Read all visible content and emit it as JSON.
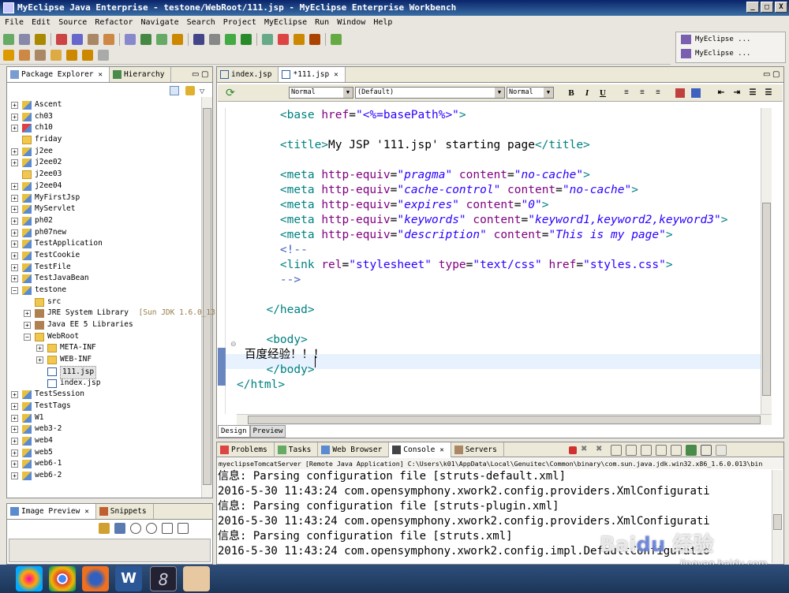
{
  "window": {
    "title": "MyEclipse Java Enterprise - testone/WebRoot/111.jsp - MyEclipse Enterprise Workbench",
    "min": "_",
    "max": "□",
    "close": "X"
  },
  "menu": [
    "File",
    "Edit",
    "Source",
    "Refactor",
    "Navigate",
    "Search",
    "Project",
    "MyEclipse",
    "Run",
    "Window",
    "Help"
  ],
  "perspective": {
    "items": [
      "MyEclipse ...",
      "MyEclipse ..."
    ]
  },
  "left_tabs": {
    "explorer": "Package Explorer",
    "hierarchy": "Hierarchy"
  },
  "tree": [
    {
      "label": "Ascent",
      "depth": 0,
      "type": "proj",
      "exp": "+"
    },
    {
      "label": "ch03",
      "depth": 0,
      "type": "proj",
      "exp": "+"
    },
    {
      "label": "ch10",
      "depth": 0,
      "type": "projE",
      "exp": "+"
    },
    {
      "label": "friday",
      "depth": 0,
      "type": "fold",
      "exp": ""
    },
    {
      "label": "j2ee",
      "depth": 0,
      "type": "proj",
      "exp": "+"
    },
    {
      "label": "j2ee02",
      "depth": 0,
      "type": "proj",
      "exp": "+"
    },
    {
      "label": "j2ee03",
      "depth": 0,
      "type": "fold",
      "exp": ""
    },
    {
      "label": "j2ee04",
      "depth": 0,
      "type": "proj",
      "exp": "+"
    },
    {
      "label": "MyFirstJsp",
      "depth": 0,
      "type": "proj",
      "exp": "+"
    },
    {
      "label": "MyServlet",
      "depth": 0,
      "type": "proj",
      "exp": "+"
    },
    {
      "label": "ph02",
      "depth": 0,
      "type": "proj",
      "exp": "+"
    },
    {
      "label": "ph07new",
      "depth": 0,
      "type": "proj",
      "exp": "+"
    },
    {
      "label": "TestApplication",
      "depth": 0,
      "type": "proj",
      "exp": "+"
    },
    {
      "label": "TestCookie",
      "depth": 0,
      "type": "proj",
      "exp": "+"
    },
    {
      "label": "TestFile",
      "depth": 0,
      "type": "proj",
      "exp": "+"
    },
    {
      "label": "TestJavaBean",
      "depth": 0,
      "type": "proj",
      "exp": "+"
    },
    {
      "label": "testone",
      "depth": 0,
      "type": "proj",
      "exp": "-"
    },
    {
      "label": "src",
      "depth": 1,
      "type": "fold",
      "exp": ""
    },
    {
      "label": "JRE System Library",
      "extra": "[Sun JDK 1.6.0_13]",
      "depth": 1,
      "type": "lib",
      "exp": "+"
    },
    {
      "label": "Java EE 5 Libraries",
      "depth": 1,
      "type": "lib",
      "exp": "+"
    },
    {
      "label": "WebRoot",
      "depth": 1,
      "type": "fold",
      "exp": "-"
    },
    {
      "label": "META-INF",
      "depth": 2,
      "type": "fold",
      "exp": "+"
    },
    {
      "label": "WEB-INF",
      "depth": 2,
      "type": "fold",
      "exp": "+"
    },
    {
      "label": "111.jsp",
      "depth": 2,
      "type": "jfile",
      "exp": "",
      "selected": true
    },
    {
      "label": "index.jsp",
      "depth": 2,
      "type": "jfile",
      "exp": ""
    },
    {
      "label": "TestSession",
      "depth": 0,
      "type": "proj",
      "exp": "+"
    },
    {
      "label": "TestTags",
      "depth": 0,
      "type": "proj",
      "exp": "+"
    },
    {
      "label": "W1",
      "depth": 0,
      "type": "proj",
      "exp": "+"
    },
    {
      "label": "web3-2",
      "depth": 0,
      "type": "proj",
      "exp": "+"
    },
    {
      "label": "web4",
      "depth": 0,
      "type": "proj",
      "exp": "+"
    },
    {
      "label": "web5",
      "depth": 0,
      "type": "proj",
      "exp": "+"
    },
    {
      "label": "web6-1",
      "depth": 0,
      "type": "proj",
      "exp": "+"
    },
    {
      "label": "web6-2",
      "depth": 0,
      "type": "proj",
      "exp": "+"
    }
  ],
  "lower_left_tabs": {
    "image": "Image Preview",
    "snippets": "Snippets"
  },
  "editor_tabs": [
    "index.jsp",
    "*111.jsp"
  ],
  "editor_toolbar": {
    "style1": "Normal",
    "font": "(Default)",
    "style2": "Normal",
    "bold": "B",
    "italic": "I",
    "underline": "U"
  },
  "code_lines": [
    [
      {
        "t": "    ",
        "c": ""
      },
      {
        "t": "<base ",
        "c": "tag"
      },
      {
        "t": "href",
        "c": "at"
      },
      {
        "t": "=",
        "c": ""
      },
      {
        "t": "\"<%=basePath%>\"",
        "c": "str"
      },
      {
        "t": ">",
        "c": "tag"
      }
    ],
    [],
    [
      {
        "t": "    ",
        "c": ""
      },
      {
        "t": "<title>",
        "c": "tag"
      },
      {
        "t": "My JSP '111.jsp' starting page",
        "c": ""
      },
      {
        "t": "</title>",
        "c": "tag"
      }
    ],
    [],
    [
      {
        "t": "    ",
        "c": ""
      },
      {
        "t": "<meta ",
        "c": "tag"
      },
      {
        "t": "http-equiv",
        "c": "at"
      },
      {
        "t": "=",
        "c": ""
      },
      {
        "t": "\"pragma\"",
        "c": "val"
      },
      {
        "t": " content",
        "c": "at"
      },
      {
        "t": "=",
        "c": ""
      },
      {
        "t": "\"no-cache\"",
        "c": "val"
      },
      {
        "t": ">",
        "c": "tag"
      }
    ],
    [
      {
        "t": "    ",
        "c": ""
      },
      {
        "t": "<meta ",
        "c": "tag"
      },
      {
        "t": "http-equiv",
        "c": "at"
      },
      {
        "t": "=",
        "c": ""
      },
      {
        "t": "\"cache-control\"",
        "c": "val"
      },
      {
        "t": " content",
        "c": "at"
      },
      {
        "t": "=",
        "c": ""
      },
      {
        "t": "\"no-cache\"",
        "c": "val"
      },
      {
        "t": ">",
        "c": "tag"
      }
    ],
    [
      {
        "t": "    ",
        "c": ""
      },
      {
        "t": "<meta ",
        "c": "tag"
      },
      {
        "t": "http-equiv",
        "c": "at"
      },
      {
        "t": "=",
        "c": ""
      },
      {
        "t": "\"expires\"",
        "c": "val"
      },
      {
        "t": " content",
        "c": "at"
      },
      {
        "t": "=",
        "c": ""
      },
      {
        "t": "\"0\"",
        "c": "val"
      },
      {
        "t": ">",
        "c": "tag"
      }
    ],
    [
      {
        "t": "    ",
        "c": ""
      },
      {
        "t": "<meta ",
        "c": "tag"
      },
      {
        "t": "http-equiv",
        "c": "at"
      },
      {
        "t": "=",
        "c": ""
      },
      {
        "t": "\"keywords\"",
        "c": "val"
      },
      {
        "t": " content",
        "c": "at"
      },
      {
        "t": "=",
        "c": ""
      },
      {
        "t": "\"keyword1,keyword2,keyword3\"",
        "c": "val"
      },
      {
        "t": ">",
        "c": "tag"
      }
    ],
    [
      {
        "t": "    ",
        "c": ""
      },
      {
        "t": "<meta ",
        "c": "tag"
      },
      {
        "t": "http-equiv",
        "c": "at"
      },
      {
        "t": "=",
        "c": ""
      },
      {
        "t": "\"description\"",
        "c": "val"
      },
      {
        "t": " content",
        "c": "at"
      },
      {
        "t": "=",
        "c": ""
      },
      {
        "t": "\"This is my page\"",
        "c": "val"
      },
      {
        "t": ">",
        "c": "tag"
      }
    ],
    [
      {
        "t": "    ",
        "c": ""
      },
      {
        "t": "<!--",
        "c": "cm"
      }
    ],
    [
      {
        "t": "    ",
        "c": ""
      },
      {
        "t": "<link ",
        "c": "tag"
      },
      {
        "t": "rel",
        "c": "at"
      },
      {
        "t": "=",
        "c": ""
      },
      {
        "t": "\"stylesheet\"",
        "c": "str"
      },
      {
        "t": " type",
        "c": "at"
      },
      {
        "t": "=",
        "c": ""
      },
      {
        "t": "\"text/css\"",
        "c": "str"
      },
      {
        "t": " href",
        "c": "at"
      },
      {
        "t": "=",
        "c": ""
      },
      {
        "t": "\"styles.css\"",
        "c": "str"
      },
      {
        "t": ">",
        "c": "tag"
      }
    ],
    [
      {
        "t": "    ",
        "c": ""
      },
      {
        "t": "-->",
        "c": "cm"
      }
    ],
    [],
    [
      {
        "t": "  ",
        "c": ""
      },
      {
        "t": "</head>",
        "c": "tag"
      }
    ],
    [],
    [
      {
        "t": "  ",
        "c": ""
      },
      {
        "t": "<body>",
        "c": "tag"
      }
    ],
    [
      {
        "t": "百度经验！！！",
        "c": ""
      }
    ],
    [
      {
        "t": "  ",
        "c": ""
      },
      {
        "t": "</body>",
        "c": "tag"
      }
    ],
    [
      {
        "t": "</html>",
        "c": "tag"
      }
    ]
  ],
  "design_tabs": [
    "Design",
    "Preview"
  ],
  "console_tabs": [
    "Problems",
    "Tasks",
    "Web Browser",
    "Console",
    "Servers"
  ],
  "console_header": "myeclipseTomcatServer [Remote Java Application] C:\\Users\\k01\\AppData\\Local\\Genuitec\\Common\\binary\\com.sun.java.jdk.win32.x86_1.6.0.013\\bin",
  "console_lines": [
    "信息: Parsing configuration file [struts-default.xml]",
    "2016-5-30 11:43:24 com.opensymphony.xwork2.config.providers.XmlConfigurati",
    "信息: Parsing configuration file [struts-plugin.xml]",
    "2016-5-30 11:43:24 com.opensymphony.xwork2.config.providers.XmlConfigurati",
    "信息: Parsing configuration file [struts.xml]",
    "2016-5-30 11:43:24 com.opensymphony.xwork2.config.impl.DefaultConfiguratio"
  ],
  "watermark": "jingyan.baidu.com"
}
